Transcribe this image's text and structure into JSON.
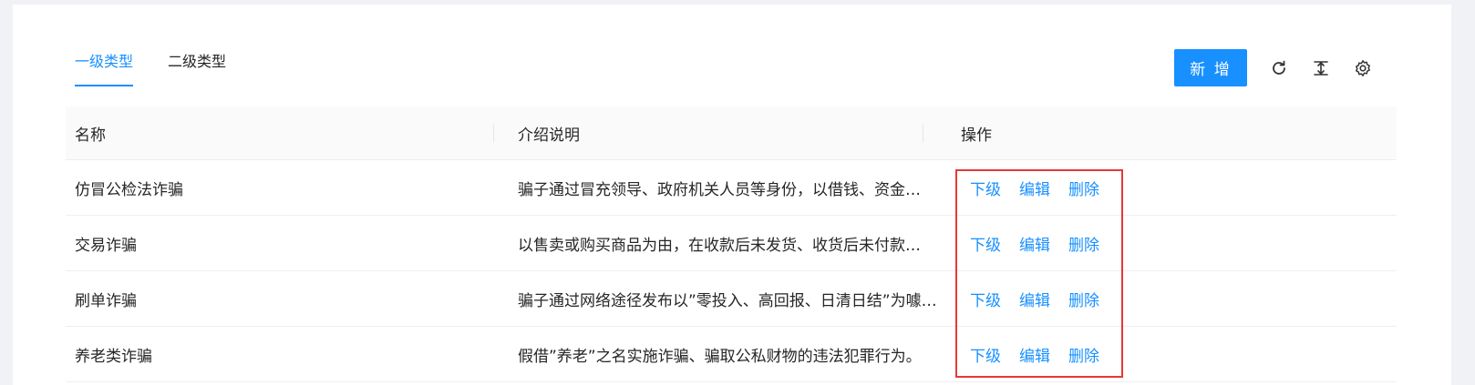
{
  "tabs": [
    "一级类型",
    "二级类型"
  ],
  "toolbar": {
    "add_label": "新 增",
    "icons": [
      "refresh-icon",
      "column-height-icon",
      "settings-icon"
    ]
  },
  "table": {
    "headers": [
      "名称",
      "介绍说明",
      "操作"
    ],
    "rows": [
      {
        "name": "仿冒公检法诈骗",
        "desc": "骗子通过冒充领导、政府机关人员等身份，以借钱、资金…"
      },
      {
        "name": "交易诈骗",
        "desc": "以售卖或购买商品为由，在收款后未发货、收货后未付款…"
      },
      {
        "name": "刷单诈骗",
        "desc": "骗子通过网络途径发布以”零投入、高回报、日清日结”为噱…"
      },
      {
        "name": "养老类诈骗",
        "desc": "假借”养老”之名实施诈骗、骗取公私财物的违法犯罪行为。"
      }
    ],
    "actions": [
      "下级",
      "编辑",
      "删除"
    ]
  },
  "colors": {
    "accent": "#1890ff",
    "highlight": "#e53935"
  }
}
